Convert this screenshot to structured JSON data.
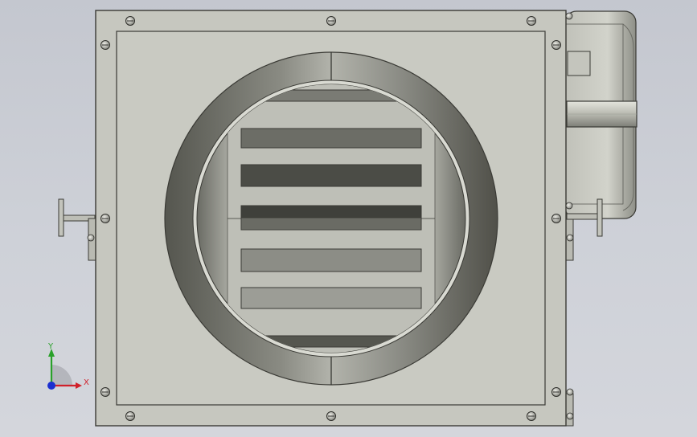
{
  "view": {
    "background_color": "#c9ccd4",
    "model_name": "",
    "part_color": "#c6c7bf",
    "edge_color": "#3a3a35"
  },
  "triad": {
    "x_label": "X",
    "y_label": "Y",
    "x_color": "#d0202a",
    "y_color": "#2aa12a",
    "z_color": "#1a2fd0"
  },
  "icons": {
    "bolt": "bolt-head-icon",
    "triad": "coordinate-triad-icon"
  }
}
